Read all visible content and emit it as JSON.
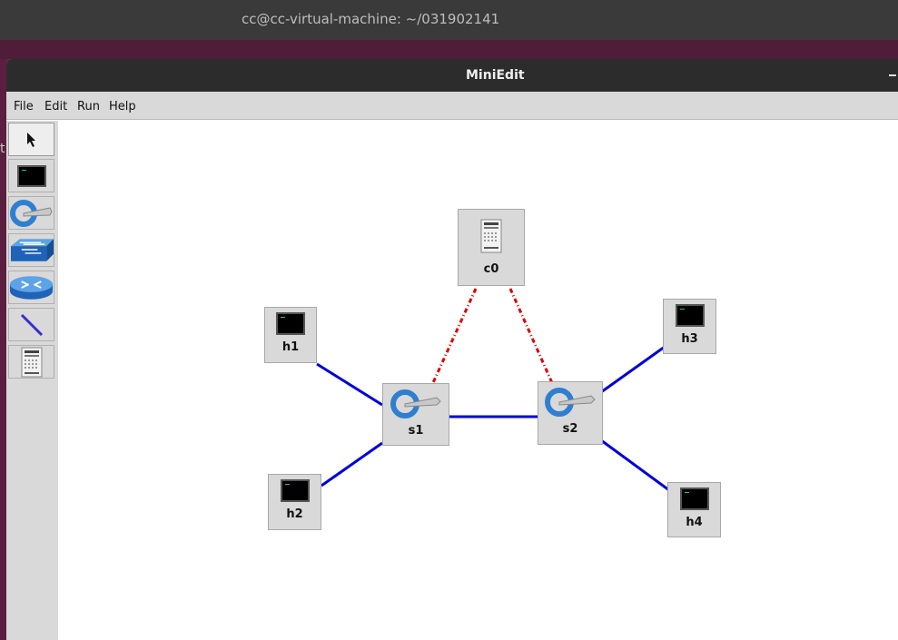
{
  "desktop": {
    "terminal_title": "cc@cc-virtual-machine: ~/031902141",
    "side_fragment": "t"
  },
  "window": {
    "title": "MiniEdit"
  },
  "menubar": {
    "items": [
      "File",
      "Edit",
      "Run",
      "Help"
    ]
  },
  "toolbar": {
    "tools": [
      {
        "name": "select",
        "icon": "arrow-cursor-icon"
      },
      {
        "name": "host",
        "icon": "terminal-icon"
      },
      {
        "name": "switch",
        "icon": "openflow-switch-icon"
      },
      {
        "name": "legacy-switch",
        "icon": "legacy-switch-icon"
      },
      {
        "name": "legacy-router",
        "icon": "router-icon"
      },
      {
        "name": "netlink",
        "icon": "link-line-icon"
      },
      {
        "name": "controller",
        "icon": "server-icon"
      }
    ],
    "active_tool": "select"
  },
  "topology": {
    "nodes": [
      {
        "id": "c0",
        "label": "c0",
        "type": "controller"
      },
      {
        "id": "h1",
        "label": "h1",
        "type": "host"
      },
      {
        "id": "h2",
        "label": "h2",
        "type": "host"
      },
      {
        "id": "h3",
        "label": "h3",
        "type": "host"
      },
      {
        "id": "h4",
        "label": "h4",
        "type": "host"
      },
      {
        "id": "s1",
        "label": "s1",
        "type": "switch"
      },
      {
        "id": "s2",
        "label": "s2",
        "type": "switch"
      }
    ],
    "links": [
      {
        "from": "h1",
        "to": "s1",
        "kind": "data"
      },
      {
        "from": "h2",
        "to": "s1",
        "kind": "data"
      },
      {
        "from": "s1",
        "to": "s2",
        "kind": "data"
      },
      {
        "from": "s2",
        "to": "h3",
        "kind": "data"
      },
      {
        "from": "s2",
        "to": "h4",
        "kind": "data"
      },
      {
        "from": "c0",
        "to": "s1",
        "kind": "control"
      },
      {
        "from": "c0",
        "to": "s2",
        "kind": "control"
      }
    ],
    "colors": {
      "data_link": "#0000dd",
      "control_link": "#dd0000",
      "switch_blue": "#2f7fd1"
    }
  }
}
